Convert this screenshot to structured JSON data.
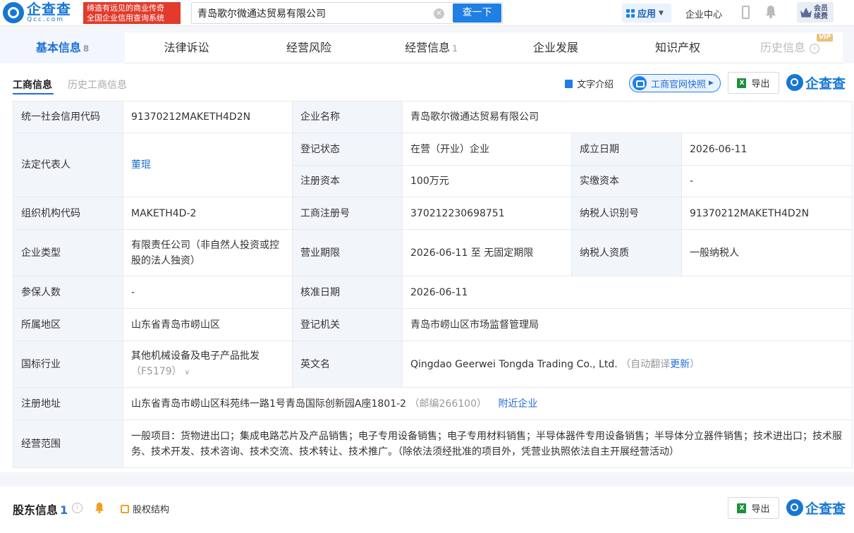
{
  "header": {
    "logo_cn": "企查查",
    "logo_en": "Qcc.com",
    "slogan_line1": "缔造有远见的商业传奇",
    "slogan_line2": "全国企业信用查询系统",
    "search_value": "青岛歌尔微通达贸易有限公司",
    "search_button": "查一下",
    "apps_label": "应用",
    "user_center": "企业中心",
    "vip_line1": "会员",
    "vip_line2": "续费"
  },
  "tabs": [
    {
      "label": "基本信息",
      "count": "8"
    },
    {
      "label": "法律诉讼",
      "count": ""
    },
    {
      "label": "经营风险",
      "count": ""
    },
    {
      "label": "经营信息",
      "count": "1"
    },
    {
      "label": "企业发展",
      "count": ""
    },
    {
      "label": "知识产权",
      "count": ""
    },
    {
      "label": "历史信息",
      "count": "",
      "badge": "VIP"
    }
  ],
  "subtabs": {
    "active": "工商信息",
    "inactive": "历史工商信息"
  },
  "toolbar": {
    "text_intro": "文字介绍",
    "snapshot": "工商官网快照",
    "export": "导出",
    "brand": "企查查"
  },
  "fields": {
    "credit_code_label": "统一社会信用代码",
    "credit_code": "91370212MAKETH4D2N",
    "company_name_label": "企业名称",
    "company_name": "青岛歌尔微通达贸易有限公司",
    "legal_rep_label": "法定代表人",
    "legal_rep": "董琨",
    "reg_status_label": "登记状态",
    "reg_status": "在营（开业）企业",
    "found_date_label": "成立日期",
    "found_date": "2026-06-11",
    "reg_capital_label": "注册资本",
    "reg_capital": "100万元",
    "paid_capital_label": "实缴资本",
    "paid_capital": "-",
    "org_code_label": "组织机构代码",
    "org_code": "MAKETH4D-2",
    "biz_reg_no_label": "工商注册号",
    "biz_reg_no": "370212230698751",
    "taxpayer_id_label": "纳税人识别号",
    "taxpayer_id": "91370212MAKETH4D2N",
    "company_type_label": "企业类型",
    "company_type": "有限责任公司（非自然人投资或控股的法人独资）",
    "biz_term_label": "营业期限",
    "biz_term": "2026-06-11 至 无固定期限",
    "taxpayer_qual_label": "纳税人资质",
    "taxpayer_qual": "一般纳税人",
    "insured_label": "参保人数",
    "insured": "-",
    "approval_date_label": "核准日期",
    "approval_date": "2026-06-11",
    "region_label": "所属地区",
    "region": "山东省青岛市崂山区",
    "reg_authority_label": "登记机关",
    "reg_authority": "青岛市崂山区市场监督管理局",
    "industry_label": "国标行业",
    "industry": "其他机械设备及电子产品批发",
    "industry_code": "（F5179）",
    "english_name_label": "英文名",
    "english_name": "Qingdao Geerwei Tongda Trading Co., Ltd.",
    "auto_translate": "（自动翻译",
    "update_link": "更新",
    "close_paren": "）",
    "address_label": "注册地址",
    "address": "山东省青岛市崂山区科苑纬一路1号青岛国际创新园A座1801-2",
    "postcode": "（邮编266100）",
    "nearby": "附近企业",
    "scope_label": "经营范围",
    "scope": "一般项目：货物进出口；集成电路芯片及产品销售；电子专用设备销售；电子专用材料销售；半导体器件专用设备销售；半导体分立器件销售；技术进出口；技术服务、技术开发、技术咨询、技术交流、技术转让、技术推广。（除依法须经批准的项目外，凭营业执照依法自主开展经营活动）"
  },
  "shareholders": {
    "title": "股东信息",
    "count": "1",
    "equity": "股权结构",
    "export": "导出",
    "brand": "企查查"
  }
}
